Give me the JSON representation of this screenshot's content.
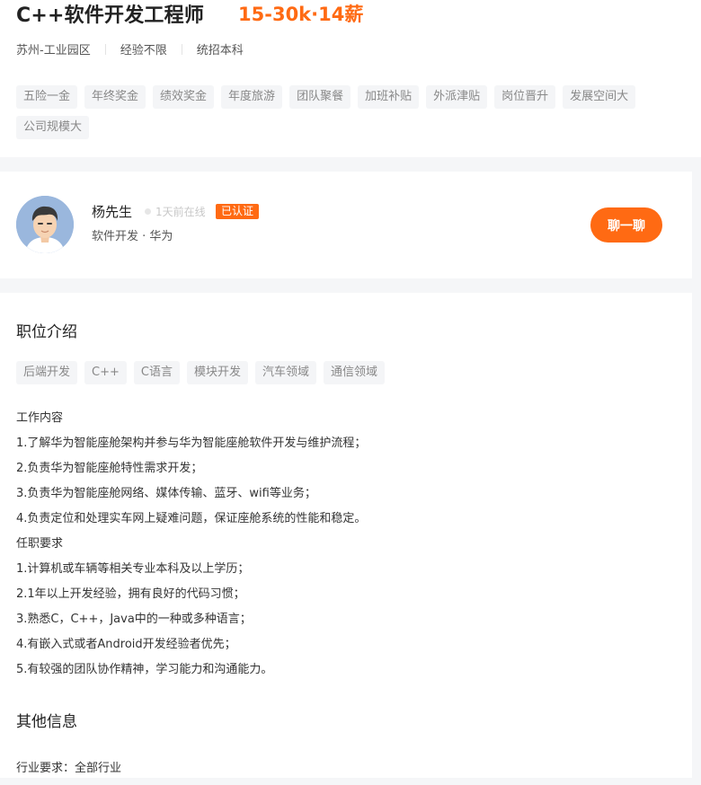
{
  "job": {
    "title": "C++软件开发工程师",
    "salary": "15-30k·14薪",
    "location": "苏州-工业园区",
    "experience": "经验不限",
    "education": "统招本科",
    "benefits": [
      "五险一金",
      "年终奖金",
      "绩效奖金",
      "年度旅游",
      "团队聚餐",
      "加班补贴",
      "外派津贴",
      "岗位晋升",
      "发展空间大",
      "公司规模大"
    ]
  },
  "recruiter": {
    "name": "杨先生",
    "online": "1天前在线",
    "verified": "已认证",
    "company": "软件开发 · 华为",
    "chat_label": "聊一聊"
  },
  "detail": {
    "section_title": "职位介绍",
    "tags": [
      "后端开发",
      "C++",
      "C语言",
      "模块开发",
      "汽车领域",
      "通信领域"
    ],
    "lines": [
      "工作内容",
      "1.了解华为智能座舱架构并参与华为智能座舱软件开发与维护流程；",
      "2.负责华为智能座舱特性需求开发；",
      "3.负责华为智能座舱网络、媒体传输、蓝牙、wifi等业务；",
      "4.负责定位和处理实车网上疑难问题，保证座舱系统的性能和稳定。",
      "任职要求",
      "1.计算机或车辆等相关专业本科及以上学历；",
      "2.1年以上开发经验，拥有良好的代码习惯；",
      "3.熟悉C，C++，Java中的一种或多种语言；",
      "4.有嵌入式或者Android开发经验者优先；",
      "5.有较强的团队协作精神，学习能力和沟通能力。"
    ],
    "other_title": "其他信息",
    "industry": "行业要求：全部行业"
  }
}
